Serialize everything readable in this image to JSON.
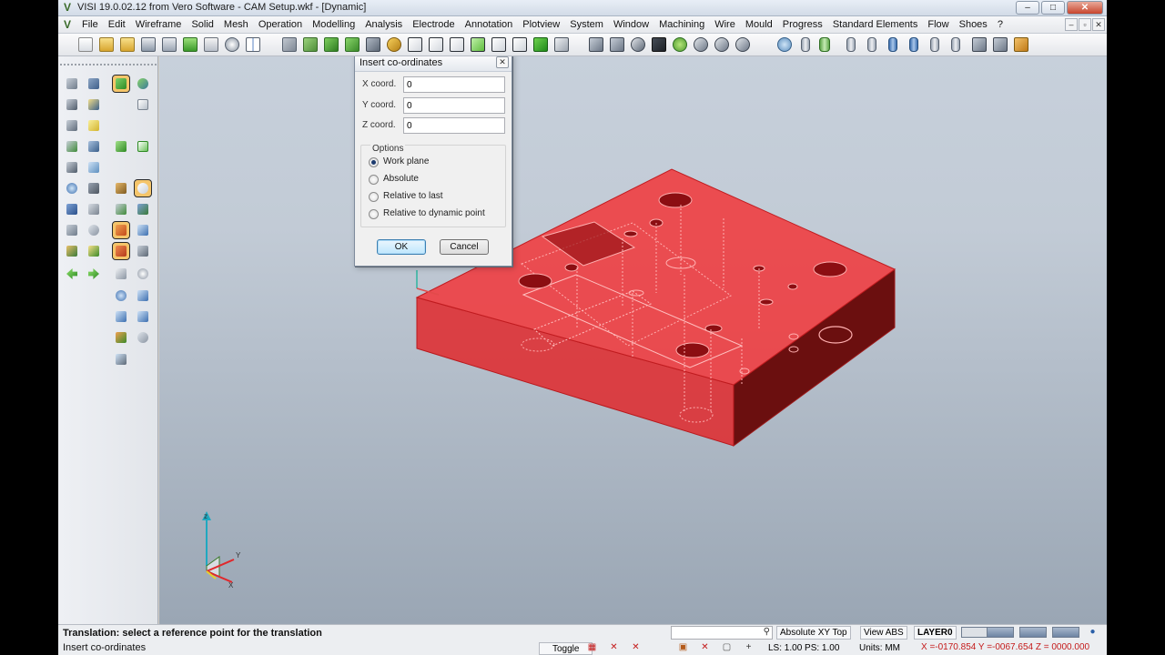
{
  "window": {
    "title": "VISI 19.0.02.12 from Vero Software - CAM Setup.wkf - [Dynamic]",
    "controls": {
      "minimize": "–",
      "maximize": "□",
      "close": "✕"
    }
  },
  "menu": {
    "items": [
      "File",
      "Edit",
      "Wireframe",
      "Solid",
      "Mesh",
      "Operation",
      "Modelling",
      "Analysis",
      "Electrode",
      "Annotation",
      "Plotview",
      "System",
      "Window",
      "Machining",
      "Wire",
      "Mould",
      "Progress",
      "Standard Elements",
      "Flow",
      "Shoes",
      "?"
    ],
    "mdi_controls": [
      "–",
      "▫",
      "✕"
    ]
  },
  "dialog": {
    "title": "Insert co-ordinates",
    "close": "✕",
    "fields": [
      {
        "label": "X coord.",
        "value": "0"
      },
      {
        "label": "Y coord.",
        "value": "0"
      },
      {
        "label": "Z coord.",
        "value": "0"
      }
    ],
    "options_label": "Options",
    "options": [
      {
        "label": "Work plane",
        "selected": true
      },
      {
        "label": "Absolute",
        "selected": false
      },
      {
        "label": "Relative to last",
        "selected": false
      },
      {
        "label": "Relative to dynamic point",
        "selected": false
      }
    ],
    "ok_label": "OK",
    "cancel_label": "Cancel"
  },
  "viewport": {
    "axis_labels": {
      "z": "z",
      "y": "Y",
      "x": "X"
    },
    "model_color": "#e8262b"
  },
  "status": {
    "prompt": "Translation: select a reference point for the translation",
    "command": "Insert co-ordinates",
    "view_mode": "Absolute XY Top",
    "view_abs": "View ABS",
    "layer": "LAYER0",
    "toggle": "Toggle",
    "ls_ps": "LS: 1.00 PS: 1.00",
    "units": "Units: MM",
    "coords": "X =-0170.854 Y =-0067.654 Z = 0000.000"
  }
}
